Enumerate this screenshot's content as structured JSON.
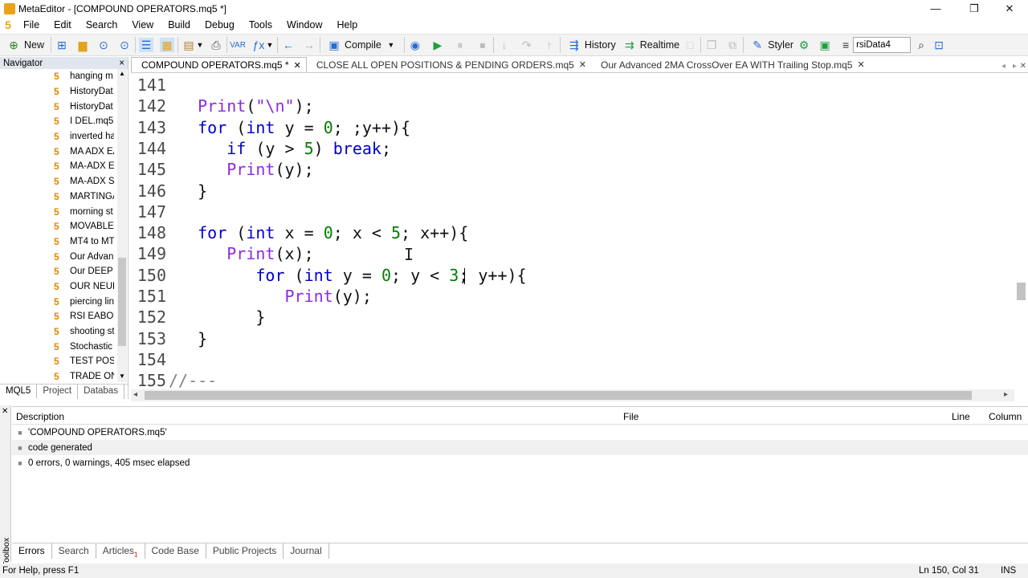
{
  "window": {
    "title": "MetaEditor - [COMPOUND OPERATORS.mq5 *]",
    "minimize": "—",
    "restore": "❐",
    "close": "✕"
  },
  "menu": [
    "File",
    "Edit",
    "Search",
    "View",
    "Build",
    "Debug",
    "Tools",
    "Window",
    "Help"
  ],
  "toolbar": {
    "new": "New",
    "compile": "Compile",
    "history": "History",
    "realtime": "Realtime",
    "styler": "Styler",
    "search_value": "rsiData4"
  },
  "navigator": {
    "title": "Navigator",
    "close": "×",
    "items": [
      "hanging m",
      "HistoryDat",
      "HistoryDat",
      "I DEL.mq5",
      "inverted ha",
      "MA ADX EA",
      "MA-ADX EA",
      "MA-ADX SI",
      "MARTINGA",
      "morning st",
      "MOVABLE",
      "MT4 to MT",
      "Our Advan",
      "Our DEEP N",
      "OUR NEUR",
      "piercing lin",
      "RSI EABOT",
      "shooting st",
      "Stochastic",
      "TEST POSIT",
      "TRADE ON"
    ],
    "icon_glyph": "5",
    "tabs": [
      "MQL5",
      "Project",
      "Databas"
    ]
  },
  "tabs": [
    {
      "label": "COMPOUND OPERATORS.mq5 *"
    },
    {
      "label": "CLOSE ALL OPEN POSITIONS & PENDING ORDERS.mq5"
    },
    {
      "label": "Our Advanced 2MA CrossOver EA WITH Trailing Stop.mq5"
    }
  ],
  "code_lines": [
    {
      "n": "141",
      "html": ""
    },
    {
      "n": "142",
      "html": "   <span class='fn'>Print</span><span class='pl'>(</span><span class='str'>\"\\n\"</span><span class='pl'>);</span>"
    },
    {
      "n": "143",
      "html": "   <span class='kw'>for</span><span class='pl'> (</span><span class='kw'>int</span><span class='pl'> y = </span><span class='num'>0</span><span class='pl'>; ;y++){</span>"
    },
    {
      "n": "144",
      "html": "      <span class='kw'>if</span><span class='pl'> (y > </span><span class='num'>5</span><span class='pl'>) </span><span class='kw'>break</span><span class='pl'>;</span>"
    },
    {
      "n": "145",
      "html": "      <span class='fn'>Print</span><span class='pl'>(y);</span>"
    },
    {
      "n": "146",
      "html": "   <span class='pl'>}</span>"
    },
    {
      "n": "147",
      "html": ""
    },
    {
      "n": "148",
      "html": "   <span class='kw'>for</span><span class='pl'> (</span><span class='kw'>int</span><span class='pl'> x = </span><span class='num'>0</span><span class='pl'>; x < </span><span class='num'>5</span><span class='pl'>; x++){</span>"
    },
    {
      "n": "149",
      "html": "      <span class='fn'>Print</span><span class='pl'>(x);</span>"
    },
    {
      "n": "150",
      "html": "         <span class='kw'>for</span><span class='pl'> (</span><span class='kw'>int</span><span class='pl'> y = </span><span class='num'>0</span><span class='pl'>; y < </span><span class='num'>3</span><span class='pl'>; y++){</span>"
    },
    {
      "n": "151",
      "html": "            <span class='fn'>Print</span><span class='pl'>(y);</span>"
    },
    {
      "n": "152",
      "html": "         <span class='pl'>}</span>"
    },
    {
      "n": "153",
      "html": "   <span class='pl'>}</span>"
    },
    {
      "n": "154",
      "html": ""
    },
    {
      "n": "155",
      "html": "<span class='cm'>//---</span>"
    }
  ],
  "errors": {
    "columns": {
      "description": "Description",
      "file": "File",
      "line": "Line",
      "column": "Column"
    },
    "rows": [
      "'COMPOUND OPERATORS.mq5'",
      "code generated",
      "0 errors, 0 warnings, 405 msec elapsed"
    ],
    "tabs": [
      "Errors",
      "Search",
      "Articles",
      "Code Base",
      "Public Projects",
      "Journal"
    ],
    "articles_badge": "1"
  },
  "toolbox": {
    "label": "Toolbox"
  },
  "status": {
    "help": "For Help, press F1",
    "position": "Ln 150, Col 31",
    "mode": "INS"
  }
}
